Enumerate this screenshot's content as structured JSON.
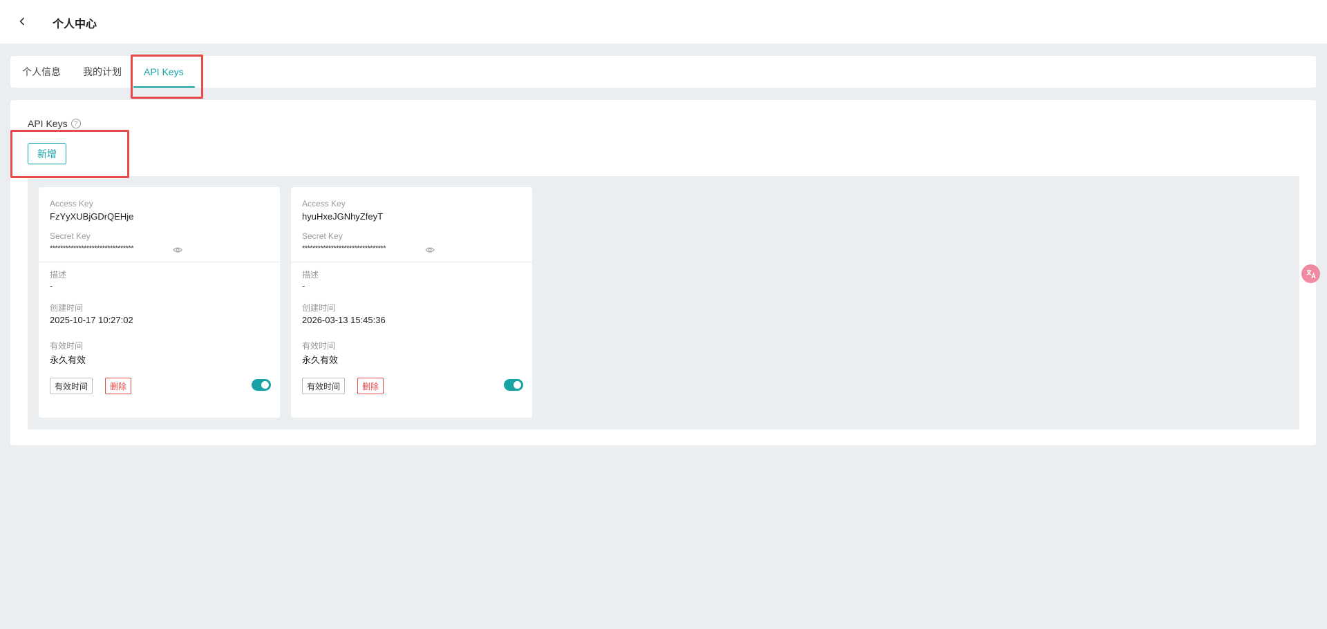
{
  "header": {
    "title": "个人中心"
  },
  "tabs": [
    {
      "label": "个人信息",
      "active": false
    },
    {
      "label": "我的计划",
      "active": false
    },
    {
      "label": "API Keys",
      "active": true
    }
  ],
  "section": {
    "title": "API Keys",
    "add_label": "新增"
  },
  "labels": {
    "access_key": "Access Key",
    "secret_key": "Secret Key",
    "description": "描述",
    "created": "创建时间",
    "validity": "有效时间",
    "btn_validity": "有效时间",
    "btn_delete": "删除"
  },
  "keys": [
    {
      "access_key": "FzYyXUBjGDrQEHje",
      "secret_masked": "********************************",
      "description": "-",
      "created": "2025-10-17 10:27:02",
      "validity": "永久有效",
      "enabled": true
    },
    {
      "access_key": "hyuHxeJGNhyZfeyT",
      "secret_masked": "********************************",
      "description": "-",
      "created": "2026-03-13 15:45:36",
      "validity": "永久有效",
      "enabled": true
    }
  ],
  "colors": {
    "accent": "#17a2a6",
    "danger": "#e84a4a",
    "highlight": "#e84a4a"
  },
  "icons": {
    "back": "chevron-left-icon",
    "help": "question-circle-icon",
    "eye": "eye-icon",
    "translate": "translate-icon"
  }
}
